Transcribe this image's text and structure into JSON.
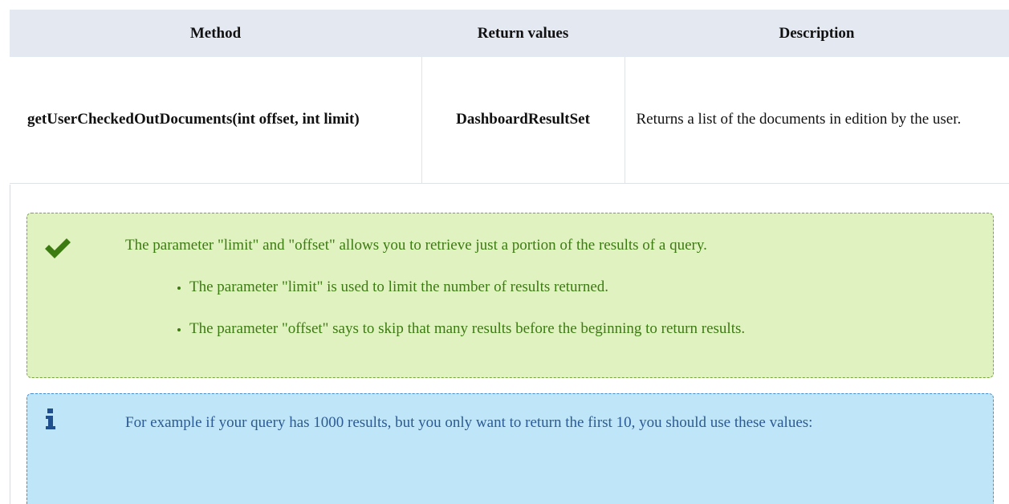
{
  "table": {
    "headers": {
      "method": "Method",
      "return_values": "Return values",
      "description": "Description"
    },
    "rows": [
      {
        "method": "getUserCheckedOutDocuments(int offset, int limit)",
        "return_values": "DashboardResultSet",
        "description": "Returns a list of the documents in edition by the user."
      }
    ]
  },
  "success_callout": {
    "icon": "checkmark-icon",
    "lead": "The parameter \"limit\" and \"offset\" allows you to retrieve just a portion of the results of a query.",
    "items": [
      "The parameter \"limit\" is used to limit the number of results returned.",
      "The parameter \"offset\" says to skip that many results before the beginning to return results."
    ]
  },
  "info_callout": {
    "icon": "info-icon",
    "lead": "For example if your query has 1000 results, but you only want to return the first 10, you should use these values:"
  },
  "colors": {
    "header_bg": "#e4e9f1",
    "success_bg": "#e0f2bf",
    "success_text": "#3c7a12",
    "info_bg": "#bfe6f8",
    "info_text": "#2c5a95"
  }
}
